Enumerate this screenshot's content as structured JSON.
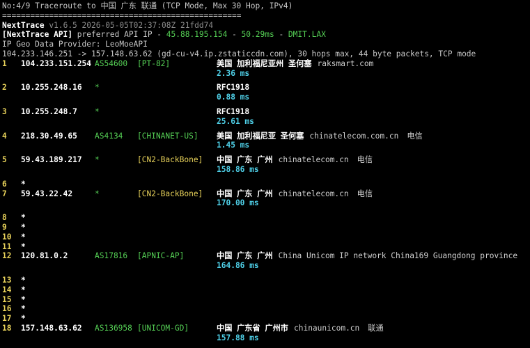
{
  "header": {
    "title": "No:4/9 Traceroute to 中国 广东 联通 (TCP Mode, Max 30 Hop, IPv4)",
    "separator": "===================================================",
    "app_name": "NextTrace",
    "version": "v1.6.5 2026-05-05T02:37:08Z 21fdd74",
    "api_label": "[NextTrace API]",
    "api_text": " preferred API IP - ",
    "api_ip": "45.88.195.154",
    "api_dash1": " - ",
    "api_latency": "50.29ms",
    "api_dash2": " - ",
    "api_node": "DMIT.LAX",
    "geo_provider": "IP Geo Data Provider: LeoMoeAPI",
    "route_info": "104.233.146.251 -> 157.148.63.62 (gd-cu-v4.ip.zstaticcdn.com), 30 hops max, 44 byte packets, TCP mode"
  },
  "hops": [
    {
      "hop": "1",
      "ip": "104.233.151.254",
      "asn": "AS54600",
      "tag": "[PT-82]",
      "tag_color": "green",
      "geo": "美国 加利福尼亚州 圣何塞",
      "domain": "raksmart.com",
      "isp": "",
      "rtt": "2.36 ms",
      "domain_offset": "176px",
      "isp_offset": ""
    },
    {
      "hop": "2",
      "ip": "10.255.248.16",
      "asn": "*",
      "tag": "",
      "tag_color": "green",
      "geo": "RFC1918",
      "domain": "",
      "isp": "",
      "rtt": "0.88 ms"
    },
    {
      "hop": "3",
      "ip": "10.255.248.7",
      "asn": "*",
      "tag": "",
      "tag_color": "green",
      "geo": "RFC1918",
      "domain": "",
      "isp": "",
      "rtt": "25.61 ms"
    },
    {
      "hop": "4",
      "ip": "218.30.49.65",
      "asn": "AS4134",
      "tag": "[CHINANET-US]",
      "tag_color": "green",
      "geo": "美国 加利福尼亚 圣何塞",
      "domain": "chinatelecom.com.cn",
      "isp": "电信",
      "rtt": "1.45 ms"
    },
    {
      "hop": "5",
      "ip": "59.43.189.217",
      "asn": "*",
      "tag": "[CN2-BackBone]",
      "tag_color": "yellow",
      "geo": "中国 广东 广州",
      "domain": "chinatelecom.cn",
      "isp": "电信",
      "rtt": "158.86 ms"
    },
    {
      "hop": "6",
      "ip": "*"
    },
    {
      "hop": "7",
      "ip": "59.43.22.42",
      "asn": "*",
      "tag": "[CN2-BackBone]",
      "tag_color": "yellow",
      "geo": "中国 广东 广州",
      "domain": "chinatelecom.cn",
      "isp": "电信",
      "rtt": "170.00 ms"
    },
    {
      "hop": "8",
      "ip": "*"
    },
    {
      "hop": "9",
      "ip": "*"
    },
    {
      "hop": "10",
      "ip": "*"
    },
    {
      "hop": "11",
      "ip": "*"
    },
    {
      "hop": "12",
      "ip": "120.81.0.2",
      "asn": "AS17816",
      "tag": "[APNIC-AP]",
      "tag_color": "green",
      "geo": "中国 广东 广州",
      "domain": "China Unicom IP network China169 Guangdong province",
      "isp": "",
      "rtt": "164.86 ms"
    },
    {
      "hop": "13",
      "ip": "*"
    },
    {
      "hop": "14",
      "ip": "*"
    },
    {
      "hop": "15",
      "ip": "*"
    },
    {
      "hop": "16",
      "ip": "*"
    },
    {
      "hop": "17",
      "ip": "*"
    },
    {
      "hop": "18",
      "ip": "157.148.63.62",
      "asn": "AS136958",
      "tag": "[UNICOM-GD]",
      "tag_color": "green",
      "geo": "中国 广东省 广州市",
      "domain": "chinaunicom.cn",
      "isp": "联通",
      "rtt": "157.88 ms"
    }
  ]
}
